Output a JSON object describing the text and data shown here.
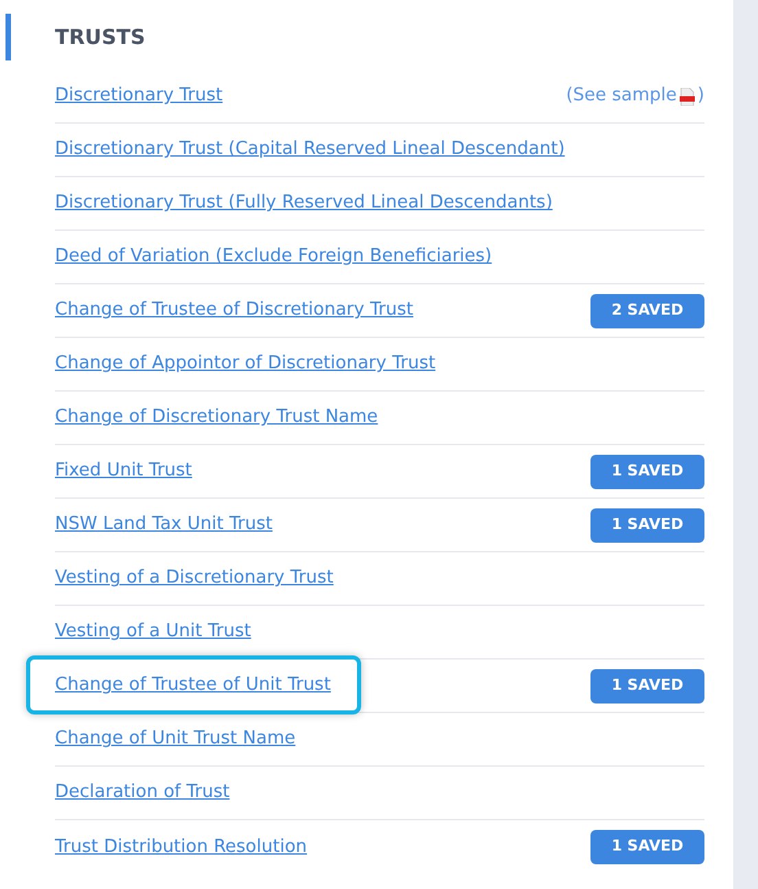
{
  "section": {
    "title": "TRUSTS"
  },
  "items": [
    {
      "label": "Discretionary Trust",
      "sample": "(See sample",
      "sample_close": ")",
      "highlighted": false
    },
    {
      "label": "Discretionary Trust (Capital Reserved Lineal Descendant)",
      "highlighted": false
    },
    {
      "label": "Discretionary Trust (Fully Reserved Lineal Descendants)",
      "highlighted": false
    },
    {
      "label": "Deed of Variation (Exclude Foreign Beneficiaries)",
      "highlighted": false
    },
    {
      "label": "Change of Trustee of Discretionary Trust",
      "saved": "2 SAVED",
      "highlighted": false
    },
    {
      "label": "Change of Appointor of Discretionary Trust",
      "highlighted": false
    },
    {
      "label": "Change of Discretionary Trust Name",
      "highlighted": false
    },
    {
      "label": "Fixed Unit Trust",
      "saved": "1 SAVED",
      "highlighted": false
    },
    {
      "label": "NSW Land Tax Unit Trust",
      "saved": "1 SAVED",
      "highlighted": false
    },
    {
      "label": "Vesting of a Discretionary Trust",
      "highlighted": false
    },
    {
      "label": "Vesting of a Unit Trust",
      "highlighted": false
    },
    {
      "label": "Change of Trustee of Unit Trust",
      "saved": "1 SAVED",
      "highlighted": true
    },
    {
      "label": "Change of Unit Trust Name",
      "highlighted": false
    },
    {
      "label": "Declaration of Trust",
      "highlighted": false
    },
    {
      "label": "Trust Distribution Resolution",
      "saved": "1 SAVED",
      "highlighted": false
    }
  ]
}
